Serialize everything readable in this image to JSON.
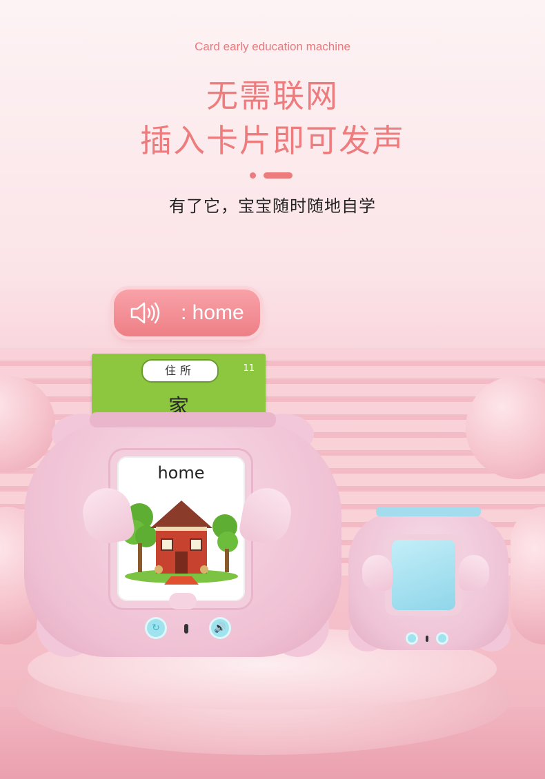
{
  "header": {
    "subtitle": "Card early education machine",
    "title_line1": "无需联网",
    "title_line2": "插入卡片即可发声",
    "tagline": "有了它，宝宝随时随地自学"
  },
  "sound_badge": {
    "icon": "speaker-icon",
    "text": ": home"
  },
  "card": {
    "category": "住所",
    "number": "11",
    "character": "家"
  },
  "device": {
    "screen_word": "home",
    "screen_image": "house-icon",
    "buttons": [
      "repeat-icon",
      "volume-icon"
    ]
  },
  "colors": {
    "accent": "#ed7c7e",
    "card_green": "#8dc63f",
    "device_pink": "#efc0d3",
    "button_cyan": "#9fe3ef"
  }
}
